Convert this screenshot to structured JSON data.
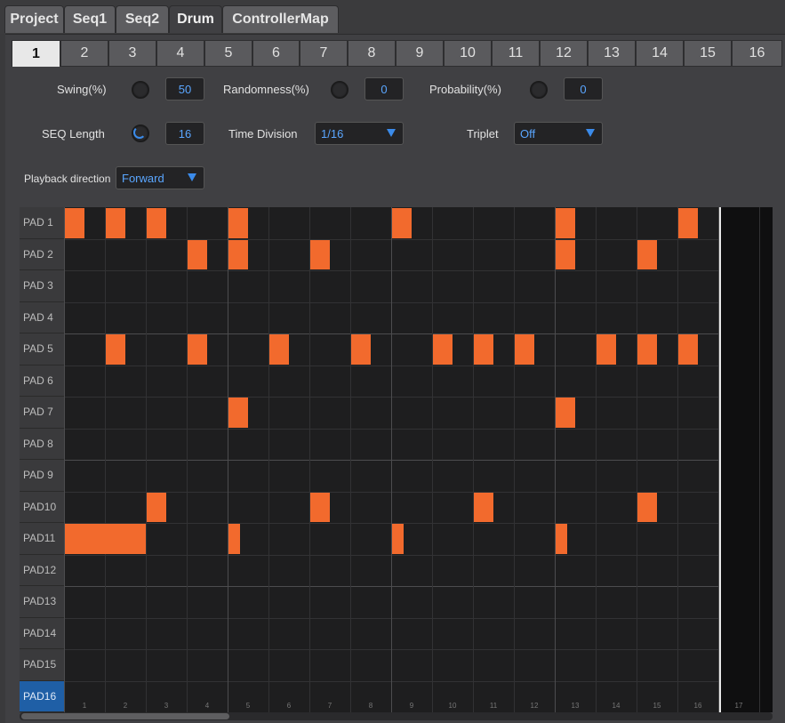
{
  "top_tabs": [
    {
      "label": "Project",
      "active": false
    },
    {
      "label": "Seq1",
      "active": false
    },
    {
      "label": "Seq2",
      "active": false
    },
    {
      "label": "Drum",
      "active": true
    },
    {
      "label": "ControllerMap",
      "active": false
    }
  ],
  "step_tabs": [
    "1",
    "2",
    "3",
    "4",
    "5",
    "6",
    "7",
    "8",
    "9",
    "10",
    "11",
    "12",
    "13",
    "14",
    "15",
    "16"
  ],
  "active_step_tab": "1",
  "controls": {
    "swing": {
      "label": "Swing(%)",
      "value": "50"
    },
    "randomness": {
      "label": "Randomness(%)",
      "value": "0"
    },
    "probability": {
      "label": "Probability(%)",
      "value": "0"
    },
    "seq_length": {
      "label": "SEQ Length",
      "value": "16"
    },
    "time_division": {
      "label": "Time Division",
      "value": "1/16"
    },
    "triplet": {
      "label": "Triplet",
      "value": "Off"
    },
    "playback_direction": {
      "label": "Playback direction",
      "value": "Forward"
    }
  },
  "pads": [
    "PAD  1",
    "PAD  2",
    "PAD  3",
    "PAD  4",
    "PAD  5",
    "PAD  6",
    "PAD  7",
    "PAD  8",
    "PAD  9",
    "PAD10",
    "PAD11",
    "PAD12",
    "PAD13",
    "PAD14",
    "PAD15",
    "PAD16"
  ],
  "selected_pad": "PAD16",
  "column_numbers": [
    "1",
    "2",
    "3",
    "4",
    "5",
    "6",
    "7",
    "8",
    "9",
    "10",
    "11",
    "12",
    "13",
    "14",
    "15",
    "16",
    "17"
  ],
  "steps": [
    {
      "pad": 1,
      "step": 1,
      "length": 1
    },
    {
      "pad": 1,
      "step": 2,
      "length": 1
    },
    {
      "pad": 1,
      "step": 3,
      "length": 1
    },
    {
      "pad": 1,
      "step": 5,
      "length": 1
    },
    {
      "pad": 1,
      "step": 9,
      "length": 1
    },
    {
      "pad": 1,
      "step": 13,
      "length": 1
    },
    {
      "pad": 1,
      "step": 16,
      "length": 1
    },
    {
      "pad": 2,
      "step": 4,
      "length": 1
    },
    {
      "pad": 2,
      "step": 5,
      "length": 1
    },
    {
      "pad": 2,
      "step": 7,
      "length": 1
    },
    {
      "pad": 2,
      "step": 13,
      "length": 1
    },
    {
      "pad": 2,
      "step": 15,
      "length": 1
    },
    {
      "pad": 5,
      "step": 2,
      "length": 1
    },
    {
      "pad": 5,
      "step": 4,
      "length": 1
    },
    {
      "pad": 5,
      "step": 6,
      "length": 1
    },
    {
      "pad": 5,
      "step": 8,
      "length": 1
    },
    {
      "pad": 5,
      "step": 10,
      "length": 1
    },
    {
      "pad": 5,
      "step": 11,
      "length": 1
    },
    {
      "pad": 5,
      "step": 12,
      "length": 1
    },
    {
      "pad": 5,
      "step": 14,
      "length": 1
    },
    {
      "pad": 5,
      "step": 15,
      "length": 1
    },
    {
      "pad": 5,
      "step": 16,
      "length": 1
    },
    {
      "pad": 7,
      "step": 5,
      "length": 1
    },
    {
      "pad": 7,
      "step": 13,
      "length": 1
    },
    {
      "pad": 10,
      "step": 3,
      "length": 1
    },
    {
      "pad": 10,
      "step": 7,
      "length": 1
    },
    {
      "pad": 10,
      "step": 11,
      "length": 1
    },
    {
      "pad": 10,
      "step": 15,
      "length": 1
    },
    {
      "pad": 11,
      "step": 1,
      "length": 2
    },
    {
      "pad": 11,
      "step": 5,
      "length": 0.6
    },
    {
      "pad": 11,
      "step": 9,
      "length": 0.6
    },
    {
      "pad": 11,
      "step": 13,
      "length": 0.6
    }
  ],
  "colors": {
    "step_on": "#f26a2d",
    "accent": "#3b8bea",
    "selected_pad": "#1f5fa6"
  }
}
